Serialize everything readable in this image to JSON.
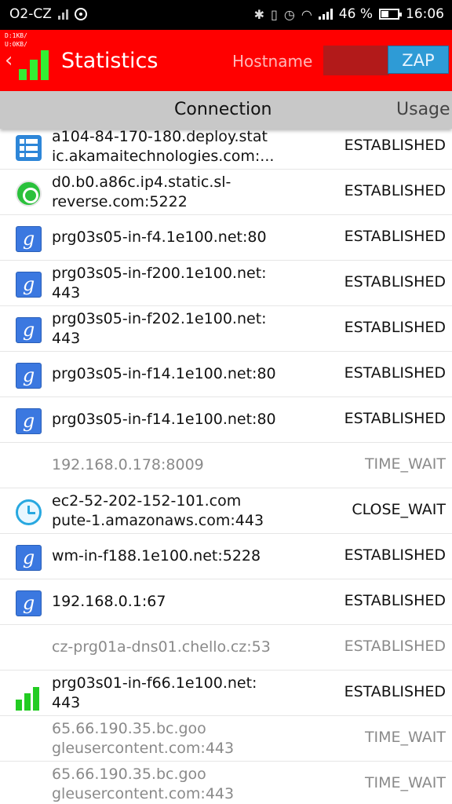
{
  "status_bar": {
    "carrier": "O2-CZ",
    "battery": "46 %",
    "battery_level": 0.46,
    "time": "16:06",
    "icons": [
      "signal-icon",
      "sync-icon",
      "bluetooth-icon",
      "vibrate-icon",
      "alarm-icon",
      "wifi-icon",
      "cell-signal-icon",
      "battery-icon"
    ]
  },
  "app_bar": {
    "traffic_down": "D:1KB/",
    "traffic_up": "U:0KB/",
    "title": "Statistics",
    "hostname_label": "Hostname",
    "zap_label": "ZAP",
    "color": "#ff0000"
  },
  "header": {
    "connection": "Connection",
    "usage": "Usage"
  },
  "connections": [
    {
      "icon": "grid-app-icon",
      "host": "a104-84-170-180.deploy.stat\nic.akamaitechnologies.com:...",
      "state": "ESTABLISHED",
      "dim": false
    },
    {
      "icon": "whatsapp-icon",
      "host": "d0.b0.a86c.ip4.static.sl-\nreverse.com:5222",
      "state": "ESTABLISHED",
      "dim": false
    },
    {
      "icon": "google-search-icon",
      "host": "prg03s05-in-f4.1e100.net:80",
      "state": "ESTABLISHED",
      "dim": false
    },
    {
      "icon": "google-search-icon",
      "host": "prg03s05-in-f200.1e100.net:\n443",
      "state": "ESTABLISHED",
      "dim": false
    },
    {
      "icon": "google-search-icon",
      "host": "prg03s05-in-f202.1e100.net:\n443",
      "state": "ESTABLISHED",
      "dim": false
    },
    {
      "icon": "google-search-icon",
      "host": "prg03s05-in-f14.1e100.net:80",
      "state": "ESTABLISHED",
      "dim": false
    },
    {
      "icon": "google-search-icon",
      "host": "prg03s05-in-f14.1e100.net:80",
      "state": "ESTABLISHED",
      "dim": false
    },
    {
      "icon": "",
      "host": "192.168.0.178:8009",
      "state": "TIME_WAIT",
      "dim": true
    },
    {
      "icon": "clock-app-icon",
      "host": "ec2-52-202-152-101.com\npute-1.amazonaws.com:443",
      "state": "CLOSE_WAIT",
      "dim": false
    },
    {
      "icon": "google-search-icon",
      "host": "wm-in-f188.1e100.net:5228",
      "state": "ESTABLISHED",
      "dim": false
    },
    {
      "icon": "google-search-icon",
      "host": "192.168.0.1:67",
      "state": "ESTABLISHED",
      "dim": false
    },
    {
      "icon": "",
      "host": "cz-prg01a-dns01.chello.cz:53",
      "state": "ESTABLISHED",
      "dim": true
    },
    {
      "icon": "signal-bars-icon",
      "host": "prg03s01-in-f66.1e100.net:\n443",
      "state": "ESTABLISHED",
      "dim": false
    },
    {
      "icon": "",
      "host": "65.66.190.35.bc.goo\ngleusercontent.com:443",
      "state": "TIME_WAIT",
      "dim": true
    },
    {
      "icon": "",
      "host": "65.66.190.35.bc.goo\ngleusercontent.com:443",
      "state": "TIME_WAIT",
      "dim": true
    }
  ]
}
